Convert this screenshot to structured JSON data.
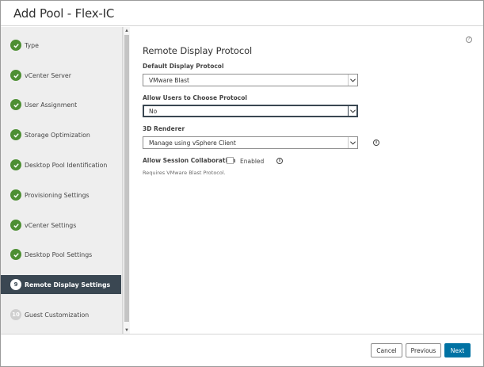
{
  "dialog": {
    "title": "Add Pool - Flex-IC"
  },
  "steps": [
    {
      "label": "Type",
      "state": "done"
    },
    {
      "label": "vCenter Server",
      "state": "done"
    },
    {
      "label": "User Assignment",
      "state": "done"
    },
    {
      "label": "Storage Optimization",
      "state": "done"
    },
    {
      "label": "Desktop Pool Identification",
      "state": "done"
    },
    {
      "label": "Provisioning Settings",
      "state": "done"
    },
    {
      "label": "vCenter Settings",
      "state": "done"
    },
    {
      "label": "Desktop Pool Settings",
      "state": "done"
    },
    {
      "label": "Remote Display Settings",
      "state": "active",
      "number": "9"
    },
    {
      "label": "Guest Customization",
      "state": "pending",
      "number": "10"
    }
  ],
  "main": {
    "section_title": "Remote Display Protocol",
    "help_icon": "help-icon",
    "default_protocol": {
      "label": "Default Display Protocol",
      "value": "VMware Blast"
    },
    "allow_choose": {
      "label": "Allow Users to Choose Protocol",
      "value": "No"
    },
    "renderer": {
      "label": "3D Renderer",
      "value": "Manage using vSphere Client"
    },
    "collaboration": {
      "label": "Allow Session Collaboration",
      "checkbox_label": "Enabled",
      "checked": false,
      "hint": "Requires VMware Blast Protocol."
    }
  },
  "footer": {
    "cancel_label": "Cancel",
    "previous_label": "Previous",
    "next_label": "Next"
  },
  "colors": {
    "accent": "#0072a3",
    "active_step": "#3a4752",
    "done_badge": "#4d8f33"
  },
  "icons": {
    "done": "check-icon",
    "info": "info-icon",
    "caret": "chevron-down-icon"
  }
}
